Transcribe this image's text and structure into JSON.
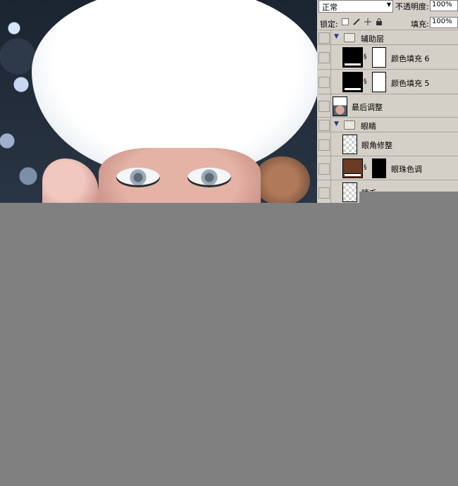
{
  "canvas": {
    "icon": "photo-canvas"
  },
  "layers_panel": {
    "blend_mode": "正常",
    "opacity_label": "不透明度:",
    "opacity_value": "100%",
    "lock_label": "锁定:",
    "fill_label": "填充:",
    "fill_value": "100%",
    "lock_icons": [
      "lock-transparent-icon",
      "lock-brush-icon",
      "lock-move-icon",
      "lock-all-icon"
    ],
    "layers": [
      {
        "type": "group",
        "name": "辅助层",
        "expanded": true
      },
      {
        "type": "fill",
        "name": "颜色填充 6",
        "thumb_color": "#000000",
        "mask_color": "#ffffff"
      },
      {
        "type": "fill",
        "name": "颜色填充 5",
        "thumb_color": "#000000",
        "mask_color": "#ffffff"
      },
      {
        "type": "image",
        "name": "最后调整"
      },
      {
        "type": "group",
        "name": "眼睛",
        "expanded": true
      },
      {
        "type": "pixel",
        "name": "眼角修整"
      },
      {
        "type": "fill",
        "name": "眼珠色调",
        "thumb_color": "#6a3a24",
        "mask_color": "#000000"
      },
      {
        "type": "pixel",
        "name": "睛毛"
      }
    ]
  }
}
